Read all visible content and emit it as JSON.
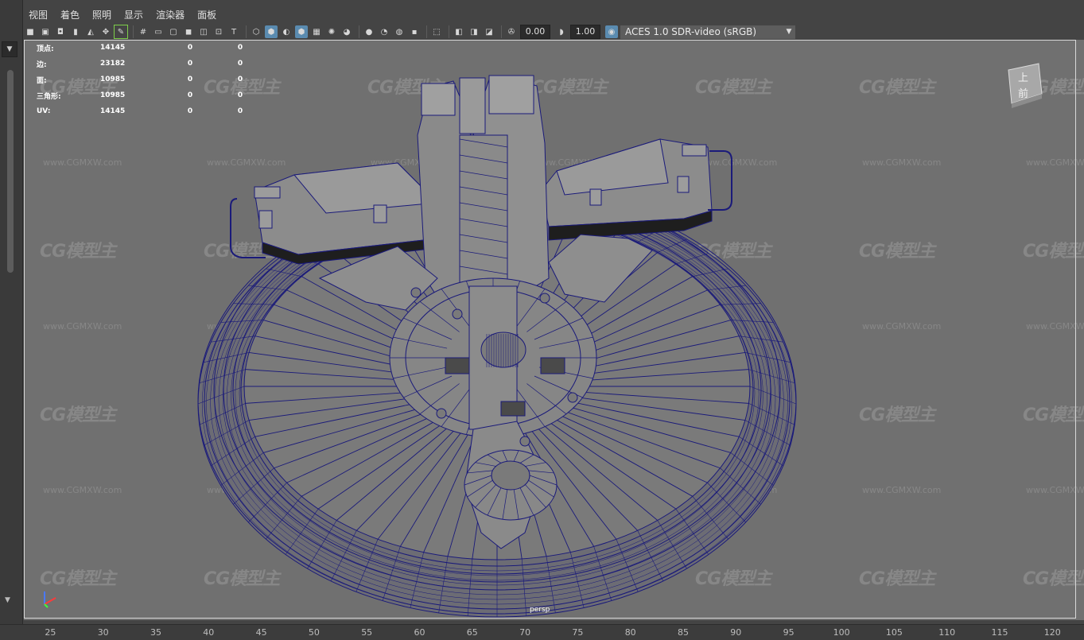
{
  "menubar": {
    "items": [
      "视图",
      "着色",
      "照明",
      "显示",
      "渲染器",
      "面板"
    ]
  },
  "toolbar": {
    "exposure_value": "0.00",
    "gamma_value": "1.00",
    "colorspace": "ACES 1.0 SDR-video (sRGB)"
  },
  "hud": {
    "rows": [
      {
        "label": "顶点:",
        "v1": "14145",
        "v2": "0",
        "v3": "0"
      },
      {
        "label": "边:",
        "v1": "23182",
        "v2": "0",
        "v3": "0"
      },
      {
        "label": "面:",
        "v1": "10985",
        "v2": "0",
        "v3": "0"
      },
      {
        "label": "三角形:",
        "v1": "10985",
        "v2": "0",
        "v3": "0"
      },
      {
        "label": "UV:",
        "v1": "14145",
        "v2": "0",
        "v3": "0"
      }
    ]
  },
  "viewport": {
    "camera_name": "persp",
    "viewcube_label": "上 前"
  },
  "watermark": {
    "logo": "CG模型主",
    "url": "www.CGMXW.com"
  },
  "timeline": {
    "ticks": [
      "25",
      "30",
      "35",
      "40",
      "45",
      "50",
      "55",
      "60",
      "65",
      "70",
      "75",
      "80",
      "85",
      "90",
      "95",
      "100",
      "105",
      "110",
      "115",
      "120"
    ]
  },
  "colors": {
    "viewport_bg": "#707070",
    "wireframe": "#1a1a7a",
    "ui_bg": "#444444"
  }
}
